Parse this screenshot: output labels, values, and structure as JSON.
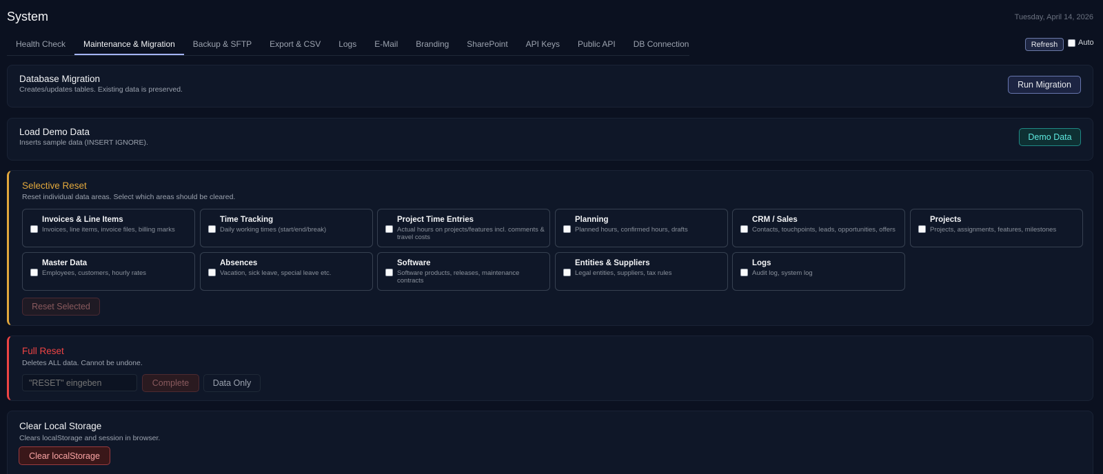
{
  "header": {
    "title": "System",
    "date": "Tuesday, April 14, 2026"
  },
  "tabs": [
    {
      "label": "Health Check",
      "active": false
    },
    {
      "label": "Maintenance & Migration",
      "active": true
    },
    {
      "label": "Backup & SFTP",
      "active": false
    },
    {
      "label": "Export & CSV",
      "active": false
    },
    {
      "label": "Logs",
      "active": false
    },
    {
      "label": "E-Mail",
      "active": false
    },
    {
      "label": "Branding",
      "active": false
    },
    {
      "label": "SharePoint",
      "active": false
    },
    {
      "label": "API Keys",
      "active": false
    },
    {
      "label": "Public API",
      "active": false
    },
    {
      "label": "DB Connection",
      "active": false
    }
  ],
  "toolbar": {
    "refresh_label": "Refresh",
    "auto_label": "Auto",
    "auto_checked": false
  },
  "migration": {
    "title": "Database Migration",
    "desc": "Creates/updates tables. Existing data is preserved.",
    "button": "Run Migration"
  },
  "demo": {
    "title": "Load Demo Data",
    "desc": "Inserts sample data (INSERT IGNORE).",
    "button": "Demo Data"
  },
  "selective": {
    "title": "Selective Reset",
    "desc": "Reset individual data areas. Select which areas should be cleared.",
    "options": [
      {
        "title": "Invoices & Line Items",
        "desc": "Invoices, line items, invoice files, billing marks"
      },
      {
        "title": "Time Tracking",
        "desc": "Daily working times (start/end/break)"
      },
      {
        "title": "Project Time Entries",
        "desc": "Actual hours on projects/features incl. comments & travel costs"
      },
      {
        "title": "Planning",
        "desc": "Planned hours, confirmed hours, drafts"
      },
      {
        "title": "CRM / Sales",
        "desc": "Contacts, touchpoints, leads, opportunities, offers"
      },
      {
        "title": "Projects",
        "desc": "Projects, assignments, features, milestones"
      },
      {
        "title": "Master Data",
        "desc": "Employees, customers, hourly rates"
      },
      {
        "title": "Absences",
        "desc": "Vacation, sick leave, special leave etc."
      },
      {
        "title": "Software",
        "desc": "Software products, releases, maintenance contracts"
      },
      {
        "title": "Entities & Suppliers",
        "desc": "Legal entities, suppliers, tax rules"
      },
      {
        "title": "Logs",
        "desc": "Audit log, system log"
      }
    ],
    "button": "Reset Selected"
  },
  "full_reset": {
    "title": "Full Reset",
    "desc": "Deletes ALL data. Cannot be undone.",
    "input_placeholder": "\"RESET\" eingeben",
    "complete_button": "Complete",
    "data_only_button": "Data Only"
  },
  "storage": {
    "title": "Clear Local Storage",
    "desc": "Clears localStorage and session in browser.",
    "button": "Clear localStorage"
  },
  "colors": {
    "accent": "#a5b4fc",
    "warning": "#e3a83c",
    "danger": "#ef4444",
    "teal": "#5ee9df"
  }
}
